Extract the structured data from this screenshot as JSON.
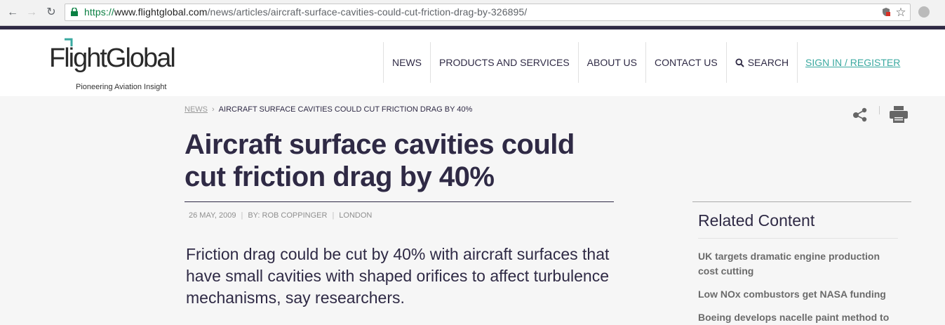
{
  "browser": {
    "url_scheme": "https://",
    "url_host": "www.flightglobal.com",
    "url_path": "/news/articles/aircraft-surface-cavities-could-cut-friction-drag-by-326895/",
    "back_icon": "back-arrow-icon",
    "forward_icon": "forward-arrow-icon",
    "reload_icon": "reload-icon",
    "lock_icon": "lock-icon",
    "star_icon": "star-icon"
  },
  "site": {
    "logo_text": "FlightGlobal",
    "tagline": "Pioneering Aviation Insight",
    "accent_color": "#3aa9a0",
    "brand_color": "#2f2a45"
  },
  "nav": {
    "items": [
      "NEWS",
      "PRODUCTS AND SERVICES",
      "ABOUT US",
      "CONTACT US"
    ],
    "search_label": "SEARCH",
    "signin_label": "SIGN IN / REGISTER"
  },
  "article": {
    "breadcrumb_parent": "NEWS",
    "breadcrumb_current": "AIRCRAFT SURFACE CAVITIES COULD CUT FRICTION DRAG BY 40%",
    "title": "Aircraft surface cavities could cut friction drag by 40%",
    "date": "26 MAY, 2009",
    "author": "BY: ROB COPPINGER",
    "location": "LONDON",
    "standfirst": "Friction drag could be cut by 40% with aircraft surfaces that have small cavities with shaped orifices to affect turbulence mechanisms, say researchers."
  },
  "related": {
    "title": "Related Content",
    "items": [
      "UK targets dramatic engine production cost cutting",
      "Low NOx combustors get NASA funding",
      "Boeing develops nacelle paint method to"
    ]
  }
}
